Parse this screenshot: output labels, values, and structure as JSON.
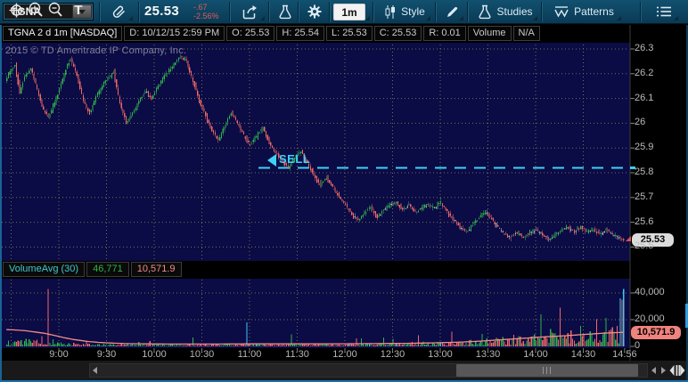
{
  "window": {
    "watermark": "2015 © TD Ameritrade IP Company, Inc."
  },
  "toolbar": {
    "symbol": "TGNA",
    "price": "25.53",
    "change": "-.67",
    "change_pct": "-2.56%",
    "timeframe": "1m",
    "style": "Style",
    "studies": "Studies",
    "patterns": "Patterns"
  },
  "header": {
    "title": "TGNA 2 d 1m [NASDAQ]",
    "fields": [
      "D: 10/12/15 2:59 PM",
      "O: 25.53",
      "H: 25.54",
      "L: 25.53",
      "C: 25.53",
      "R: 0.01",
      "Volume",
      "N/A"
    ]
  },
  "price_axis": {
    "labels": [
      "26.3",
      "26.2",
      "26.1",
      "26",
      "25.9",
      "25.8",
      "25.7",
      "25.6",
      "25.5"
    ],
    "last_price_badge": "25.53"
  },
  "volume_study": {
    "label": "VolumeAvg (30)",
    "volume_value": "46,771",
    "avg_value": "10,571.9"
  },
  "volume_axis": {
    "labels": [
      "40,000",
      "20,000",
      "0"
    ],
    "avg_badge": "10,571.9"
  },
  "time_axis": [
    {
      "label": "9:00",
      "t": 540
    },
    {
      "label": "9:30",
      "t": 570
    },
    {
      "label": "10:00",
      "t": 600
    },
    {
      "label": "10:30",
      "t": 630
    },
    {
      "label": "11:00",
      "t": 660
    },
    {
      "label": "11:30",
      "t": 690
    },
    {
      "label": "12:00",
      "t": 720
    },
    {
      "label": "12:30",
      "t": 750
    },
    {
      "label": "13:00",
      "t": 780
    },
    {
      "label": "13:30",
      "t": 810
    },
    {
      "label": "14:00",
      "t": 840
    },
    {
      "label": "14:30",
      "t": 870
    },
    {
      "label": "14:56",
      "t": 896
    }
  ],
  "annotations": {
    "sell": {
      "label": "SELL",
      "price": 25.82,
      "minute": 673
    }
  },
  "bottom_toolbar": {
    "text_tool": "T"
  },
  "icons": {
    "toolbar": [
      "link-icon",
      "share-icon",
      "flask-icon",
      "gear-icon",
      "candlestick-style-icon",
      "pencil-icon",
      "studies-flask-icon",
      "patterns-wave-icon",
      "menu-list-icon",
      "line-chart-icon",
      "chevron-down-icon"
    ],
    "bottom": [
      "pan-crosshair-icon",
      "zoom-in-icon",
      "zoom-out-icon",
      "text-tool-icon",
      "scrollbar",
      "splitter-icon"
    ]
  },
  "chart_data": {
    "type": "candlestick",
    "symbol": "TGNA",
    "exchange": "NASDAQ",
    "interval": "1m",
    "range": "2 d",
    "ohlc_current": {
      "open": 25.53,
      "high": 25.54,
      "low": 25.53,
      "close": 25.53,
      "bar_range": 0.01
    },
    "last_price": 25.53,
    "change": -0.67,
    "change_pct": -2.56,
    "y_range": [
      25.5,
      26.3
    ],
    "x_start_minute": 507,
    "x_end_minute": 896,
    "grid": "dotted",
    "price_path": [
      [
        507,
        26.17
      ],
      [
        510,
        26.21
      ],
      [
        513,
        26.24
      ],
      [
        516,
        26.12
      ],
      [
        519,
        26.19
      ],
      [
        523,
        26.22
      ],
      [
        526,
        26.16
      ],
      [
        530,
        26.07
      ],
      [
        534,
        26.02
      ],
      [
        538,
        26.08
      ],
      [
        542,
        26.16
      ],
      [
        545,
        26.22
      ],
      [
        548,
        26.26
      ],
      [
        552,
        26.19
      ],
      [
        556,
        26.09
      ],
      [
        560,
        26.04
      ],
      [
        565,
        26.12
      ],
      [
        570,
        26.17
      ],
      [
        575,
        26.21
      ],
      [
        579,
        26.08
      ],
      [
        583,
        26.0
      ],
      [
        587,
        26.04
      ],
      [
        591,
        26.09
      ],
      [
        595,
        26.13
      ],
      [
        599,
        26.1
      ],
      [
        603,
        26.15
      ],
      [
        607,
        26.19
      ],
      [
        612,
        26.23
      ],
      [
        617,
        26.27
      ],
      [
        621,
        26.25
      ],
      [
        625,
        26.17
      ],
      [
        629,
        26.09
      ],
      [
        633,
        26.03
      ],
      [
        637,
        25.97
      ],
      [
        641,
        25.93
      ],
      [
        645,
        25.99
      ],
      [
        649,
        26.04
      ],
      [
        653,
        26.0
      ],
      [
        657,
        25.95
      ],
      [
        661,
        25.91
      ],
      [
        665,
        25.95
      ],
      [
        669,
        25.98
      ],
      [
        673,
        25.92
      ],
      [
        677,
        25.88
      ],
      [
        681,
        25.85
      ],
      [
        685,
        25.82
      ],
      [
        689,
        25.86
      ],
      [
        693,
        25.89
      ],
      [
        697,
        25.84
      ],
      [
        701,
        25.79
      ],
      [
        705,
        25.75
      ],
      [
        709,
        25.78
      ],
      [
        713,
        25.74
      ],
      [
        717,
        25.7
      ],
      [
        721,
        25.67
      ],
      [
        725,
        25.63
      ],
      [
        729,
        25.61
      ],
      [
        733,
        25.64
      ],
      [
        737,
        25.66
      ],
      [
        741,
        25.62
      ],
      [
        745,
        25.65
      ],
      [
        749,
        25.67
      ],
      [
        753,
        25.68
      ],
      [
        757,
        25.65
      ],
      [
        761,
        25.67
      ],
      [
        765,
        25.64
      ],
      [
        769,
        25.66
      ],
      [
        773,
        25.67
      ],
      [
        777,
        25.66
      ],
      [
        781,
        25.68
      ],
      [
        785,
        25.64
      ],
      [
        789,
        25.61
      ],
      [
        793,
        25.58
      ],
      [
        797,
        25.56
      ],
      [
        801,
        25.59
      ],
      [
        805,
        25.62
      ],
      [
        809,
        25.64
      ],
      [
        813,
        25.61
      ],
      [
        817,
        25.58
      ],
      [
        821,
        25.55
      ],
      [
        825,
        25.54
      ],
      [
        829,
        25.56
      ],
      [
        833,
        25.54
      ],
      [
        837,
        25.56
      ],
      [
        841,
        25.57
      ],
      [
        845,
        25.55
      ],
      [
        849,
        25.53
      ],
      [
        853,
        25.55
      ],
      [
        857,
        25.57
      ],
      [
        861,
        25.58
      ],
      [
        865,
        25.56
      ],
      [
        869,
        25.58
      ],
      [
        873,
        25.56
      ],
      [
        877,
        25.57
      ],
      [
        881,
        25.55
      ],
      [
        885,
        25.57
      ],
      [
        889,
        25.55
      ],
      [
        893,
        25.54
      ],
      [
        896,
        25.53
      ]
    ],
    "volume": {
      "current": 46771,
      "avg_current": 10571.9,
      "axis_max": 40000,
      "envelope": [
        [
          507,
          2600
        ],
        [
          515,
          3600
        ],
        [
          524,
          3000
        ],
        [
          533,
          2600
        ],
        [
          542,
          2000
        ],
        [
          552,
          1500
        ],
        [
          565,
          1150
        ],
        [
          585,
          950
        ],
        [
          615,
          950
        ],
        [
          645,
          1100
        ],
        [
          675,
          1250
        ],
        [
          705,
          1250
        ],
        [
          735,
          1500
        ],
        [
          765,
          1950
        ],
        [
          785,
          2500
        ],
        [
          805,
          3300
        ],
        [
          825,
          4400
        ],
        [
          845,
          5600
        ],
        [
          865,
          6900
        ],
        [
          885,
          8200
        ],
        [
          896,
          9200
        ]
      ],
      "avg_path": [
        [
          507,
          12600
        ],
        [
          513,
          12300
        ],
        [
          519,
          11700
        ],
        [
          525,
          10800
        ],
        [
          531,
          9800
        ],
        [
          537,
          8300
        ],
        [
          543,
          6600
        ],
        [
          550,
          5000
        ],
        [
          558,
          3700
        ],
        [
          566,
          2900
        ],
        [
          575,
          2400
        ],
        [
          585,
          2000
        ],
        [
          600,
          1800
        ],
        [
          620,
          1700
        ],
        [
          640,
          1750
        ],
        [
          660,
          1850
        ],
        [
          680,
          1900
        ],
        [
          700,
          1850
        ],
        [
          720,
          1950
        ],
        [
          740,
          2100
        ],
        [
          760,
          2300
        ],
        [
          775,
          2600
        ],
        [
          790,
          3100
        ],
        [
          800,
          3600
        ],
        [
          810,
          4300
        ],
        [
          820,
          5100
        ],
        [
          830,
          5900
        ],
        [
          840,
          6700
        ],
        [
          850,
          7400
        ],
        [
          860,
          8100
        ],
        [
          870,
          8900
        ],
        [
          880,
          9700
        ],
        [
          888,
          10200
        ],
        [
          896,
          10571.9
        ]
      ],
      "spikes": [
        [
          529,
          7800,
          "red"
        ],
        [
          533,
          43000,
          "red"
        ],
        [
          536,
          5200,
          "green"
        ],
        [
          624,
          6800,
          "green"
        ],
        [
          658,
          18000,
          "cyan"
        ],
        [
          686,
          9000,
          "green"
        ],
        [
          766,
          8200,
          "red"
        ],
        [
          806,
          9500,
          "green"
        ],
        [
          826,
          8800,
          "red"
        ],
        [
          843,
          24000,
          "green"
        ],
        [
          849,
          13000,
          "green"
        ],
        [
          855,
          29000,
          "red"
        ],
        [
          862,
          12000,
          "red"
        ],
        [
          868,
          15500,
          "green"
        ],
        [
          874,
          11500,
          "green"
        ],
        [
          878,
          20500,
          "red"
        ],
        [
          884,
          21500,
          "green"
        ],
        [
          888,
          14500,
          "red"
        ],
        [
          893,
          36000,
          "cyan"
        ],
        [
          895,
          43000,
          "cyan"
        ]
      ]
    },
    "colors": {
      "up": "#2fb34a",
      "down": "#ef6a64",
      "doji": "#c8c8c8",
      "cyan": "#3bc8f5",
      "avg_line": "#f28c86",
      "grid": "#73734a",
      "background": "#0b0b46",
      "annotation": "#3ed1f4"
    }
  }
}
